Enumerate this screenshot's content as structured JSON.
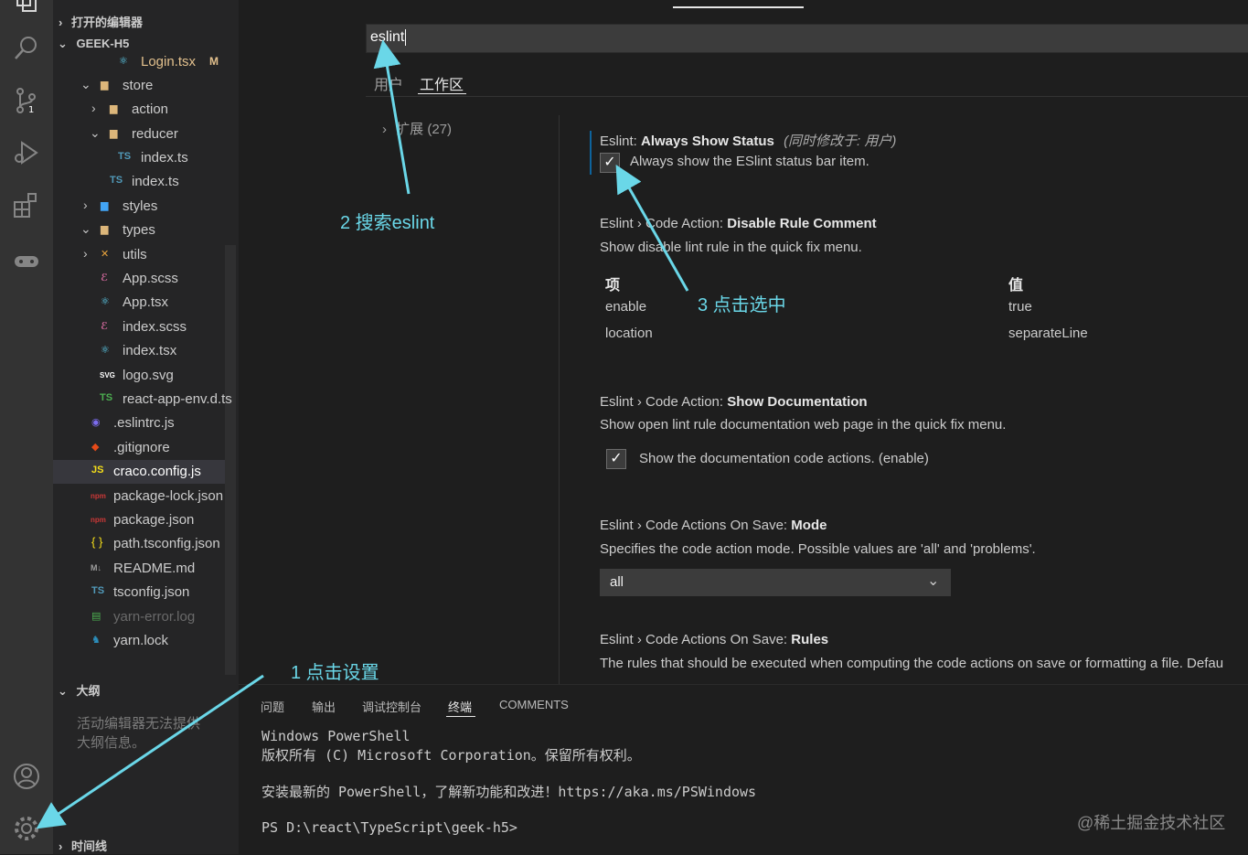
{
  "activity_bar": {
    "icons": [
      "explorer-icon",
      "search-icon",
      "source-control-icon",
      "run-debug-icon",
      "extensions-icon",
      "remote-icon",
      "account-icon",
      "settings-gear-icon"
    ],
    "scm_badge": "1"
  },
  "sidebar": {
    "open_editors": "打开的编辑器",
    "project": "GEEK-H5",
    "tree": [
      {
        "label": "Login.tsx",
        "status": "M",
        "icon": "react-icon"
      },
      {
        "label": "store",
        "icon": "folder-icon"
      },
      {
        "label": "action",
        "icon": "folder-icon"
      },
      {
        "label": "reducer",
        "icon": "folder-open-icon"
      },
      {
        "label": "index.ts",
        "icon": "ts-icon",
        "icon_text": "TS"
      },
      {
        "label": "index.ts",
        "icon": "ts-icon",
        "icon_text": "TS"
      },
      {
        "label": "styles",
        "icon": "folder-icon"
      },
      {
        "label": "types",
        "icon": "folder-open-icon"
      },
      {
        "label": "utils",
        "icon": "folder-icon"
      },
      {
        "label": "App.scss",
        "icon": "sass-icon"
      },
      {
        "label": "App.tsx",
        "icon": "react-icon"
      },
      {
        "label": "index.scss",
        "icon": "sass-icon"
      },
      {
        "label": "index.tsx",
        "icon": "react-icon"
      },
      {
        "label": "logo.svg",
        "icon": "svg-icon",
        "icon_text": "SVG"
      },
      {
        "label": "react-app-env.d.ts",
        "icon": "ts-icon",
        "icon_text": "TS"
      },
      {
        "label": ".eslintrc.js",
        "icon": "eslint-icon"
      },
      {
        "label": ".gitignore",
        "icon": "git-icon"
      },
      {
        "label": "craco.config.js",
        "icon": "js-icon",
        "icon_text": "JS"
      },
      {
        "label": "package-lock.json",
        "icon": "npm-icon"
      },
      {
        "label": "package.json",
        "icon": "npm-icon"
      },
      {
        "label": "path.tsconfig.json",
        "icon": "json-icon",
        "icon_text": "{ }"
      },
      {
        "label": "README.md",
        "icon": "markdown-icon",
        "icon_text": "M↓"
      },
      {
        "label": "tsconfig.json",
        "icon": "tsconfig-icon",
        "icon_text": "TS"
      },
      {
        "label": "yarn-error.log",
        "icon": "log-icon"
      },
      {
        "label": "yarn.lock",
        "icon": "yarn-icon"
      }
    ],
    "outline": "大纲",
    "outline_msg1": "活动编辑器无法提供",
    "outline_msg2": "大纲信息。",
    "timeline": "时间线"
  },
  "settings": {
    "search_value": "eslint",
    "tabs": [
      "用户",
      "工作区"
    ],
    "active_tab": "工作区",
    "toc": "扩展 (27)",
    "items": {
      "always_show_status": {
        "prefix": "Eslint: ",
        "name": "Always Show Status",
        "modified": "(同时修改于: 用户)",
        "checkbox_label": "Always show the ESlint status bar item.",
        "checked": true
      },
      "disable_rule_comment": {
        "prefix": "Eslint › Code Action: ",
        "name": "Disable Rule Comment",
        "desc": "Show disable lint rule in the quick fix menu.",
        "col_item": "项",
        "col_value": "值",
        "rows": [
          [
            "enable",
            "true"
          ],
          [
            "location",
            "separateLine"
          ]
        ]
      },
      "show_documentation": {
        "prefix": "Eslint › Code Action: ",
        "name": "Show Documentation",
        "desc": "Show open lint rule documentation web page in the quick fix menu.",
        "checkbox_label": "Show the documentation code actions. (enable)",
        "checked": true
      },
      "on_save_mode": {
        "prefix": "Eslint › Code Actions On Save: ",
        "name": "Mode",
        "desc": "Specifies the code action mode. Possible values are 'all' and 'problems'.",
        "value": "all"
      },
      "on_save_rules": {
        "prefix": "Eslint › Code Actions On Save: ",
        "name": "Rules",
        "desc": "The rules that should be executed when computing the code actions on save or formatting a file. Defau"
      }
    }
  },
  "panel": {
    "tabs": [
      "问题",
      "输出",
      "调试控制台",
      "终端",
      "COMMENTS"
    ],
    "active_tab": "终端",
    "terminal_lines": [
      "Windows PowerShell",
      "版权所有 (C) Microsoft Corporation。保留所有权利。",
      "",
      "安装最新的 PowerShell，了解新功能和改进！https://aka.ms/PSWindows",
      "",
      "PS D:\\react\\TypeScript\\geek-h5>"
    ]
  },
  "annotations": {
    "step1": "1 点击设置",
    "step2": "2 搜索eslint",
    "step3": "3 点击选中",
    "color": "#6ad7e8"
  },
  "watermark": "@稀土掘金技术社区",
  "colors": {
    "activity_bg": "#333333",
    "sidebar_bg": "#252526",
    "editor_bg": "#1e1e1e",
    "modified": "#e2c08d",
    "accent_tab": "#e7e7e7"
  }
}
